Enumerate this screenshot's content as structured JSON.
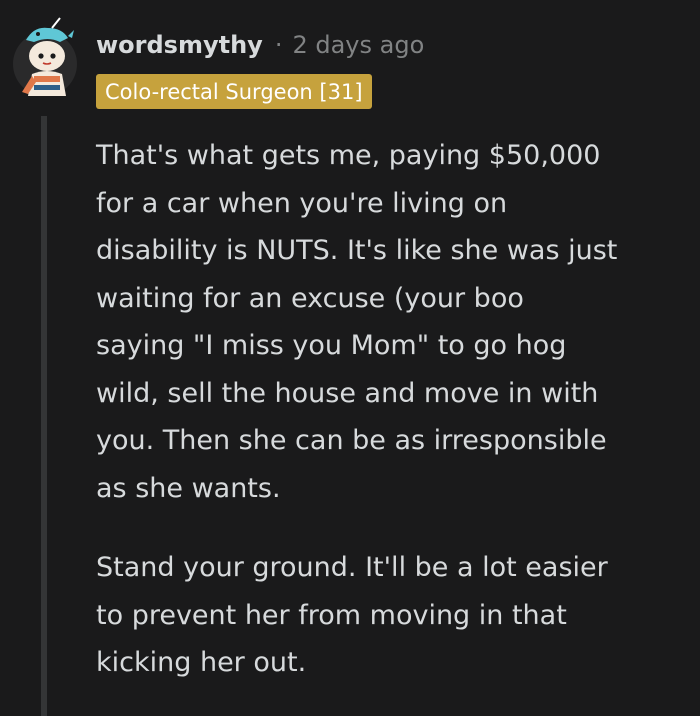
{
  "comment": {
    "username": "wordsmythy",
    "separator": "·",
    "timestamp": "2 days ago",
    "flair": "Colo-rectal Surgeon [31]",
    "paragraphs": [
      "That's what gets me, paying $50,000\nfor a car when you're living on\ndisability is NUTS. It's like she was just\nwaiting for an excuse (your boo\nsaying \"I miss you Mom\" to go hog\nwild, sell the house and move in with\nyou. Then she can be as irresponsible\nas she wants.",
      "Stand your ground. It'll be a lot easier\nto prevent her from moving in that\nkicking her out."
    ]
  },
  "colors": {
    "background": "#1a1a1b",
    "text": "#d7dadc",
    "meta": "#818384",
    "flair_bg": "#c6a23d",
    "thread_line": "#343536"
  },
  "icons": {
    "avatar": "snoo-avatar-icon"
  }
}
